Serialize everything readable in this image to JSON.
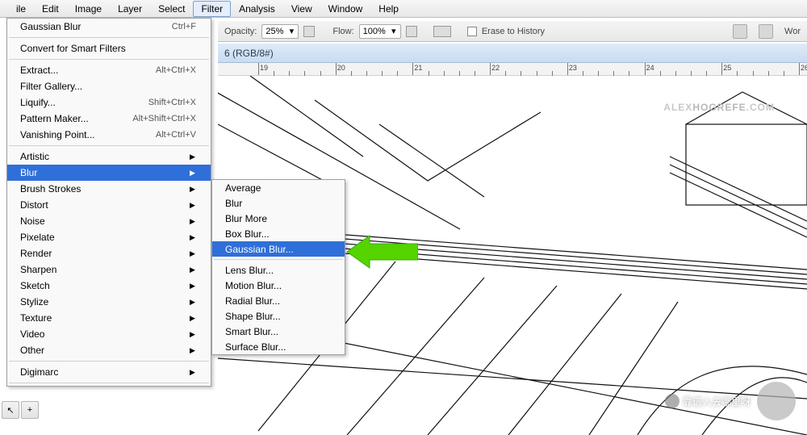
{
  "menubar": {
    "items": [
      "ile",
      "Edit",
      "Image",
      "Layer",
      "Select",
      "Filter",
      "Analysis",
      "View",
      "Window",
      "Help"
    ],
    "active_index": 5
  },
  "filter_menu": {
    "last_filter": {
      "label": "Gaussian Blur",
      "shortcut": "Ctrl+F"
    },
    "convert": "Convert for Smart Filters",
    "group1": [
      {
        "label": "Extract...",
        "shortcut": "Alt+Ctrl+X"
      },
      {
        "label": "Filter Gallery...",
        "shortcut": ""
      },
      {
        "label": "Liquify...",
        "shortcut": "Shift+Ctrl+X"
      },
      {
        "label": "Pattern Maker...",
        "shortcut": "Alt+Shift+Ctrl+X"
      },
      {
        "label": "Vanishing Point...",
        "shortcut": "Alt+Ctrl+V"
      }
    ],
    "group2": [
      "Artistic",
      "Blur",
      "Brush Strokes",
      "Distort",
      "Noise",
      "Pixelate",
      "Render",
      "Sharpen",
      "Sketch",
      "Stylize",
      "Texture",
      "Video",
      "Other"
    ],
    "group3": [
      "Digimarc"
    ],
    "highlighted": "Blur"
  },
  "blur_submenu": {
    "items": [
      "Average",
      "Blur",
      "Blur More",
      "Box Blur...",
      "Gaussian Blur...",
      "Lens Blur...",
      "Motion Blur...",
      "Radial Blur...",
      "Shape Blur...",
      "Smart Blur...",
      "Surface Blur..."
    ],
    "highlighted": "Gaussian Blur..."
  },
  "options_bar": {
    "opacity_label": "Opacity:",
    "opacity_value": "25%",
    "flow_label": "Flow:",
    "flow_value": "100%",
    "erase_label": "Erase to History",
    "right_label": "Wor"
  },
  "document": {
    "title_tail": "6 (RGB/8#)"
  },
  "ruler": {
    "marks": [
      "19",
      "20",
      "21",
      "22",
      "23",
      "24",
      "25",
      "26"
    ]
  },
  "watermark": {
    "part1": "ALEX",
    "part2": "HOGREFE",
    "suffix": ".COM"
  },
  "bottom_watermark": "靠谱人去哪里呀",
  "toolbox": {
    "a": "↖",
    "b": "+"
  }
}
